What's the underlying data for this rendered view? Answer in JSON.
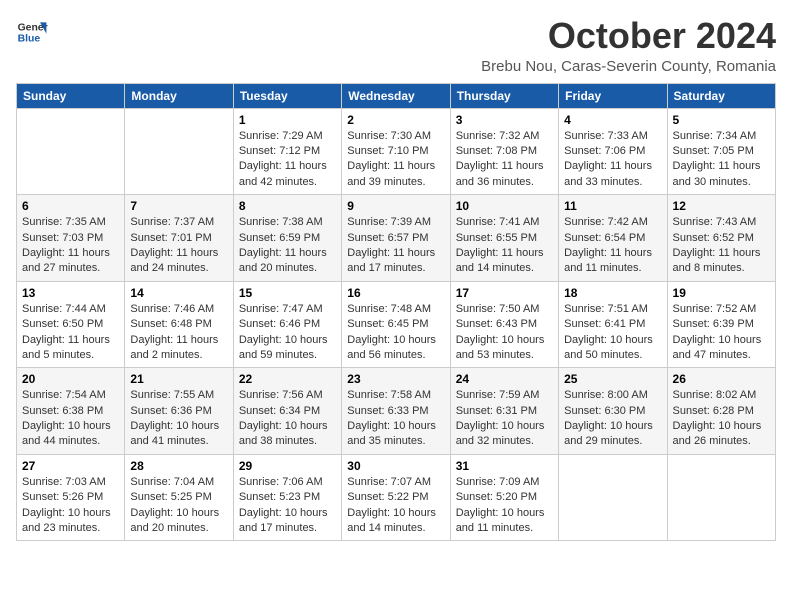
{
  "logo": {
    "line1": "General",
    "line2": "Blue"
  },
  "title": "October 2024",
  "location": "Brebu Nou, Caras-Severin County, Romania",
  "days_of_week": [
    "Sunday",
    "Monday",
    "Tuesday",
    "Wednesday",
    "Thursday",
    "Friday",
    "Saturday"
  ],
  "weeks": [
    [
      {
        "day": "",
        "info": ""
      },
      {
        "day": "",
        "info": ""
      },
      {
        "day": "1",
        "info": "Sunrise: 7:29 AM\nSunset: 7:12 PM\nDaylight: 11 hours and 42 minutes."
      },
      {
        "day": "2",
        "info": "Sunrise: 7:30 AM\nSunset: 7:10 PM\nDaylight: 11 hours and 39 minutes."
      },
      {
        "day": "3",
        "info": "Sunrise: 7:32 AM\nSunset: 7:08 PM\nDaylight: 11 hours and 36 minutes."
      },
      {
        "day": "4",
        "info": "Sunrise: 7:33 AM\nSunset: 7:06 PM\nDaylight: 11 hours and 33 minutes."
      },
      {
        "day": "5",
        "info": "Sunrise: 7:34 AM\nSunset: 7:05 PM\nDaylight: 11 hours and 30 minutes."
      }
    ],
    [
      {
        "day": "6",
        "info": "Sunrise: 7:35 AM\nSunset: 7:03 PM\nDaylight: 11 hours and 27 minutes."
      },
      {
        "day": "7",
        "info": "Sunrise: 7:37 AM\nSunset: 7:01 PM\nDaylight: 11 hours and 24 minutes."
      },
      {
        "day": "8",
        "info": "Sunrise: 7:38 AM\nSunset: 6:59 PM\nDaylight: 11 hours and 20 minutes."
      },
      {
        "day": "9",
        "info": "Sunrise: 7:39 AM\nSunset: 6:57 PM\nDaylight: 11 hours and 17 minutes."
      },
      {
        "day": "10",
        "info": "Sunrise: 7:41 AM\nSunset: 6:55 PM\nDaylight: 11 hours and 14 minutes."
      },
      {
        "day": "11",
        "info": "Sunrise: 7:42 AM\nSunset: 6:54 PM\nDaylight: 11 hours and 11 minutes."
      },
      {
        "day": "12",
        "info": "Sunrise: 7:43 AM\nSunset: 6:52 PM\nDaylight: 11 hours and 8 minutes."
      }
    ],
    [
      {
        "day": "13",
        "info": "Sunrise: 7:44 AM\nSunset: 6:50 PM\nDaylight: 11 hours and 5 minutes."
      },
      {
        "day": "14",
        "info": "Sunrise: 7:46 AM\nSunset: 6:48 PM\nDaylight: 11 hours and 2 minutes."
      },
      {
        "day": "15",
        "info": "Sunrise: 7:47 AM\nSunset: 6:46 PM\nDaylight: 10 hours and 59 minutes."
      },
      {
        "day": "16",
        "info": "Sunrise: 7:48 AM\nSunset: 6:45 PM\nDaylight: 10 hours and 56 minutes."
      },
      {
        "day": "17",
        "info": "Sunrise: 7:50 AM\nSunset: 6:43 PM\nDaylight: 10 hours and 53 minutes."
      },
      {
        "day": "18",
        "info": "Sunrise: 7:51 AM\nSunset: 6:41 PM\nDaylight: 10 hours and 50 minutes."
      },
      {
        "day": "19",
        "info": "Sunrise: 7:52 AM\nSunset: 6:39 PM\nDaylight: 10 hours and 47 minutes."
      }
    ],
    [
      {
        "day": "20",
        "info": "Sunrise: 7:54 AM\nSunset: 6:38 PM\nDaylight: 10 hours and 44 minutes."
      },
      {
        "day": "21",
        "info": "Sunrise: 7:55 AM\nSunset: 6:36 PM\nDaylight: 10 hours and 41 minutes."
      },
      {
        "day": "22",
        "info": "Sunrise: 7:56 AM\nSunset: 6:34 PM\nDaylight: 10 hours and 38 minutes."
      },
      {
        "day": "23",
        "info": "Sunrise: 7:58 AM\nSunset: 6:33 PM\nDaylight: 10 hours and 35 minutes."
      },
      {
        "day": "24",
        "info": "Sunrise: 7:59 AM\nSunset: 6:31 PM\nDaylight: 10 hours and 32 minutes."
      },
      {
        "day": "25",
        "info": "Sunrise: 8:00 AM\nSunset: 6:30 PM\nDaylight: 10 hours and 29 minutes."
      },
      {
        "day": "26",
        "info": "Sunrise: 8:02 AM\nSunset: 6:28 PM\nDaylight: 10 hours and 26 minutes."
      }
    ],
    [
      {
        "day": "27",
        "info": "Sunrise: 7:03 AM\nSunset: 5:26 PM\nDaylight: 10 hours and 23 minutes."
      },
      {
        "day": "28",
        "info": "Sunrise: 7:04 AM\nSunset: 5:25 PM\nDaylight: 10 hours and 20 minutes."
      },
      {
        "day": "29",
        "info": "Sunrise: 7:06 AM\nSunset: 5:23 PM\nDaylight: 10 hours and 17 minutes."
      },
      {
        "day": "30",
        "info": "Sunrise: 7:07 AM\nSunset: 5:22 PM\nDaylight: 10 hours and 14 minutes."
      },
      {
        "day": "31",
        "info": "Sunrise: 7:09 AM\nSunset: 5:20 PM\nDaylight: 10 hours and 11 minutes."
      },
      {
        "day": "",
        "info": ""
      },
      {
        "day": "",
        "info": ""
      }
    ]
  ]
}
